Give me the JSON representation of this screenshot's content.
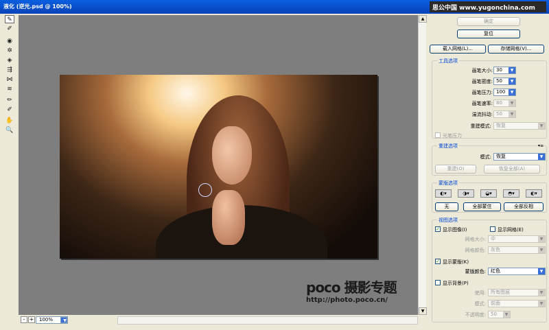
{
  "window": {
    "title": "液化 (逆光.psd @ 100%)",
    "watermark_site": "思公中国 www.yugonchina.com"
  },
  "tools": [
    {
      "icon": "warp-tool-icon",
      "glyph": "✎"
    },
    {
      "icon": "reconstruct-tool-icon",
      "glyph": "✐"
    },
    {
      "icon": "twirl-clockwise-icon",
      "glyph": "◉"
    },
    {
      "icon": "pucker-tool-icon",
      "glyph": "✲"
    },
    {
      "icon": "bloat-tool-icon",
      "glyph": "◈"
    },
    {
      "icon": "push-left-tool-icon",
      "glyph": "⇶"
    },
    {
      "icon": "mirror-tool-icon",
      "glyph": "⋈"
    },
    {
      "icon": "turbulence-tool-icon",
      "glyph": "≋"
    },
    {
      "icon": "freeze-mask-tool-icon",
      "glyph": "✏"
    },
    {
      "icon": "thaw-mask-tool-icon",
      "glyph": "✐"
    },
    {
      "icon": "hand-tool-icon",
      "glyph": "✋"
    },
    {
      "icon": "zoom-tool-icon",
      "glyph": "🔍"
    }
  ],
  "zoom": {
    "minus": "-",
    "plus": "+",
    "value": "100%"
  },
  "panel": {
    "ok": "确定",
    "reset": "复位",
    "load_mesh": "载入网格(L)...",
    "save_mesh": "存储网格(V)...",
    "tool_options": {
      "title": "工具选项",
      "brush_size_label": "画笔大小:",
      "brush_size": "30",
      "brush_density_label": "画笔密度:",
      "brush_density": "50",
      "brush_pressure_label": "画笔压力:",
      "brush_pressure": "100",
      "brush_rate_label": "画笔速率:",
      "brush_rate": "80",
      "turbulent_jitter_label": "湍流抖动:",
      "turbulent_jitter": "50",
      "reconstruct_mode_label": "重建模式:",
      "reconstruct_mode": "恢复",
      "stylus_pressure": "光笔压力"
    },
    "reconstruct_options": {
      "title": "重建选项",
      "mode_label": "模式:",
      "mode": "恢复",
      "reconstruct_btn": "重建(O)",
      "restore_all_btn": "恢复全部(A)"
    },
    "mask_options": {
      "title": "蒙版选项",
      "none": "无",
      "mask_all": "全部蒙住",
      "invert_all": "全部反相"
    },
    "view_options": {
      "title": "视图选项",
      "show_image": "显示图像(I)",
      "show_mesh": "显示网格(E)",
      "mesh_size_label": "网格大小:",
      "mesh_size": "中",
      "mesh_color_label": "网格颜色:",
      "mesh_color": "灰色",
      "show_mask": "显示蒙版(K)",
      "mask_color_label": "蒙版颜色:",
      "mask_color": "红色",
      "show_backdrop": "显示背景(P)",
      "use_label": "使用:",
      "use": "所有图层",
      "mode_label": "模式:",
      "mode": "前面",
      "opacity_label": "不透明度:",
      "opacity": "50"
    }
  },
  "overlay": {
    "logo": "poco 摄影专题",
    "url": "http://photo.poco.cn/"
  }
}
